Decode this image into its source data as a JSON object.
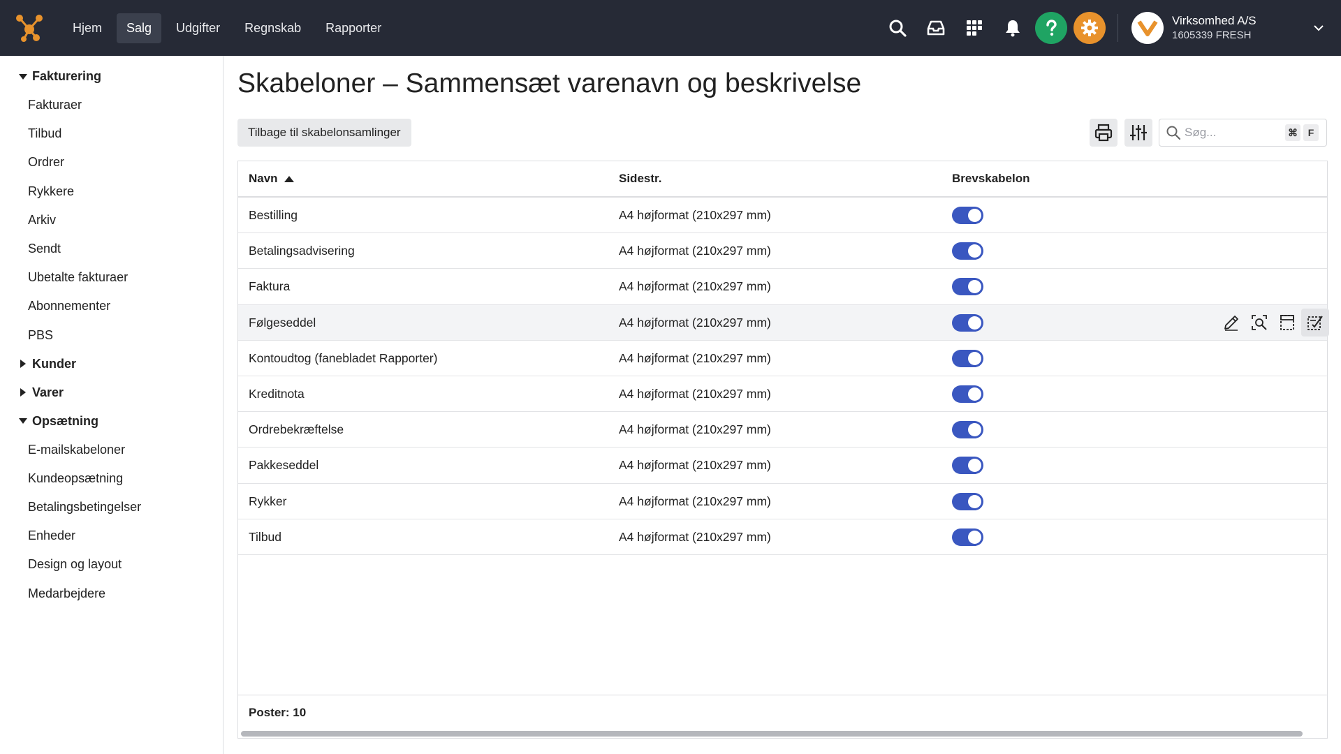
{
  "topbar": {
    "nav": [
      "Hjem",
      "Salg",
      "Udgifter",
      "Regnskab",
      "Rapporter"
    ],
    "active_nav": "Salg",
    "icons": [
      "search-icon",
      "inbox-icon",
      "apps-grid-icon",
      "bell-icon",
      "help-icon",
      "settings-icon"
    ],
    "company": {
      "name": "Virksomhed A/S",
      "sub": "1605339 FRESH"
    }
  },
  "sidebar": {
    "groups": [
      {
        "label": "Fakturering",
        "expanded": true,
        "items": [
          "Fakturaer",
          "Tilbud",
          "Ordrer",
          "Rykkere",
          "Arkiv",
          "Sendt",
          "Ubetalte fakturaer",
          "Abonnementer",
          "PBS"
        ]
      },
      {
        "label": "Kunder",
        "expanded": false,
        "items": []
      },
      {
        "label": "Varer",
        "expanded": false,
        "items": []
      },
      {
        "label": "Opsætning",
        "expanded": true,
        "items": [
          "E-mailskabeloner",
          "Kundeopsætning",
          "Betalingsbetingelser",
          "Enheder",
          "Design og layout",
          "Medarbejdere"
        ]
      }
    ]
  },
  "main": {
    "title": "Skabeloner – Sammensæt varenavn og beskrivelse",
    "back_button": "Tilbage til skabelonsamlinger",
    "search": {
      "placeholder": "Søg...",
      "shortcut_keys": [
        "⌘",
        "F"
      ]
    },
    "table": {
      "columns": [
        "Navn",
        "Sidestr.",
        "Brevskabelon"
      ],
      "sorted_by": "Navn",
      "sort_direction": "asc",
      "rows": [
        {
          "name": "Bestilling",
          "size": "A4 højformat (210x297 mm)",
          "letter_template": true
        },
        {
          "name": "Betalingsadvisering",
          "size": "A4 højformat (210x297 mm)",
          "letter_template": true
        },
        {
          "name": "Faktura",
          "size": "A4 højformat (210x297 mm)",
          "letter_template": true
        },
        {
          "name": "Følgeseddel",
          "size": "A4 højformat (210x297 mm)",
          "letter_template": true
        },
        {
          "name": "Kontoudtog (fanebladet Rapporter)",
          "size": "A4 højformat (210x297 mm)",
          "letter_template": true
        },
        {
          "name": "Kreditnota",
          "size": "A4 højformat (210x297 mm)",
          "letter_template": true
        },
        {
          "name": "Ordrebekræftelse",
          "size": "A4 højformat (210x297 mm)",
          "letter_template": true
        },
        {
          "name": "Pakkeseddel",
          "size": "A4 højformat (210x297 mm)",
          "letter_template": true
        },
        {
          "name": "Rykker",
          "size": "A4 højformat (210x297 mm)",
          "letter_template": true
        },
        {
          "name": "Tilbud",
          "size": "A4 højformat (210x297 mm)",
          "letter_template": true
        }
      ],
      "hover_row": "Følgeseddel",
      "row_action_icons": [
        "edit-icon",
        "preview-icon",
        "layout-icon",
        "compose-icon"
      ],
      "footer": "Poster: 10"
    }
  },
  "colors": {
    "topbar": "#262a36",
    "toggle_on": "#3a57c0",
    "help": "#1fa463",
    "settings": "#e8922c"
  }
}
